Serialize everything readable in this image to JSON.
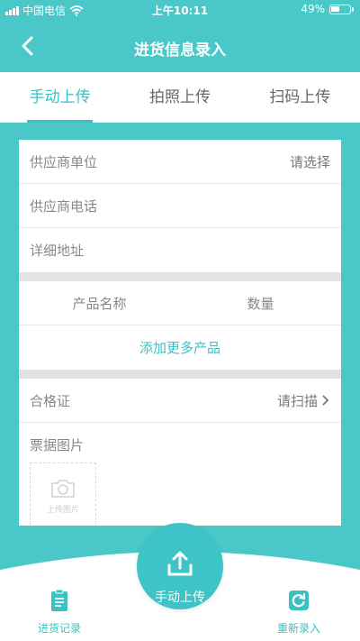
{
  "status_bar": {
    "carrier": "中国电信",
    "time": "上午10:11",
    "battery": "49%",
    "battery_level": 0.49
  },
  "nav": {
    "title": "进货信息录入",
    "back_icon": "chevron-left-icon"
  },
  "tabs": [
    {
      "label": "手动上传",
      "active": true
    },
    {
      "label": "拍照上传",
      "active": false
    },
    {
      "label": "扫码上传",
      "active": false
    }
  ],
  "form": {
    "supplier_unit_label": "供应商单位",
    "supplier_unit_value": "请选择",
    "supplier_phone_label": "供应商电话",
    "address_label": "详细地址",
    "product_name_header": "产品名称",
    "quantity_header": "数量",
    "add_more_label": "添加更多产品",
    "certificate_label": "合格证",
    "certificate_action": "请扫描",
    "receipt_label": "票据图片",
    "upload_label": "上传图片"
  },
  "bottom": {
    "records_label": "进货记录",
    "main_button_label": "手动上传",
    "reenter_label": "重新录入"
  },
  "colors": {
    "accent": "#39c1c4",
    "background": "#4ac7c8"
  }
}
